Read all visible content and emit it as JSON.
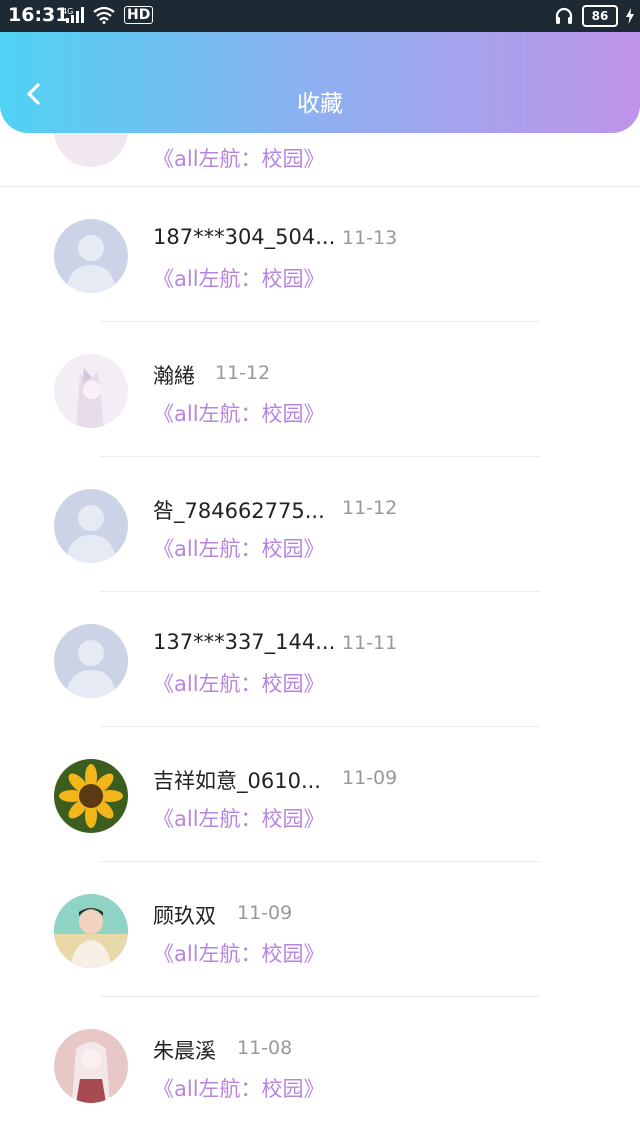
{
  "status_bar": {
    "time": "16:31",
    "network": "4G",
    "hd": "HD",
    "battery": "86"
  },
  "header": {
    "title": "收藏"
  },
  "partial_item": {
    "work": "《all左航：校园》"
  },
  "items": [
    {
      "name": "187***304_504...",
      "date": "11-13",
      "work": "《all左航：校园》",
      "avatar": "default"
    },
    {
      "name": "瀚綣",
      "date": "11-12",
      "work": "《all左航：校园》",
      "avatar": "anime-girl"
    },
    {
      "name": "咎_784662775...",
      "date": "11-12",
      "work": "《all左航：校园》",
      "avatar": "default"
    },
    {
      "name": "137***337_144...",
      "date": "11-11",
      "work": "《all左航：校园》",
      "avatar": "default"
    },
    {
      "name": "吉祥如意_0610...",
      "date": "11-09",
      "work": "《all左航：校园》",
      "avatar": "sunflower"
    },
    {
      "name": "顾玖双",
      "date": "11-09",
      "work": "《all左航：校园》",
      "avatar": "person-photo"
    },
    {
      "name": "朱晨溪",
      "date": "11-08",
      "work": "《all左航：校园》",
      "avatar": "anime-pink"
    }
  ],
  "colors": {
    "header_gradient_start": "#4fd2f3",
    "header_gradient_end": "#bf93e9",
    "accent_purple": "#b785df",
    "date_gray": "#999999"
  }
}
